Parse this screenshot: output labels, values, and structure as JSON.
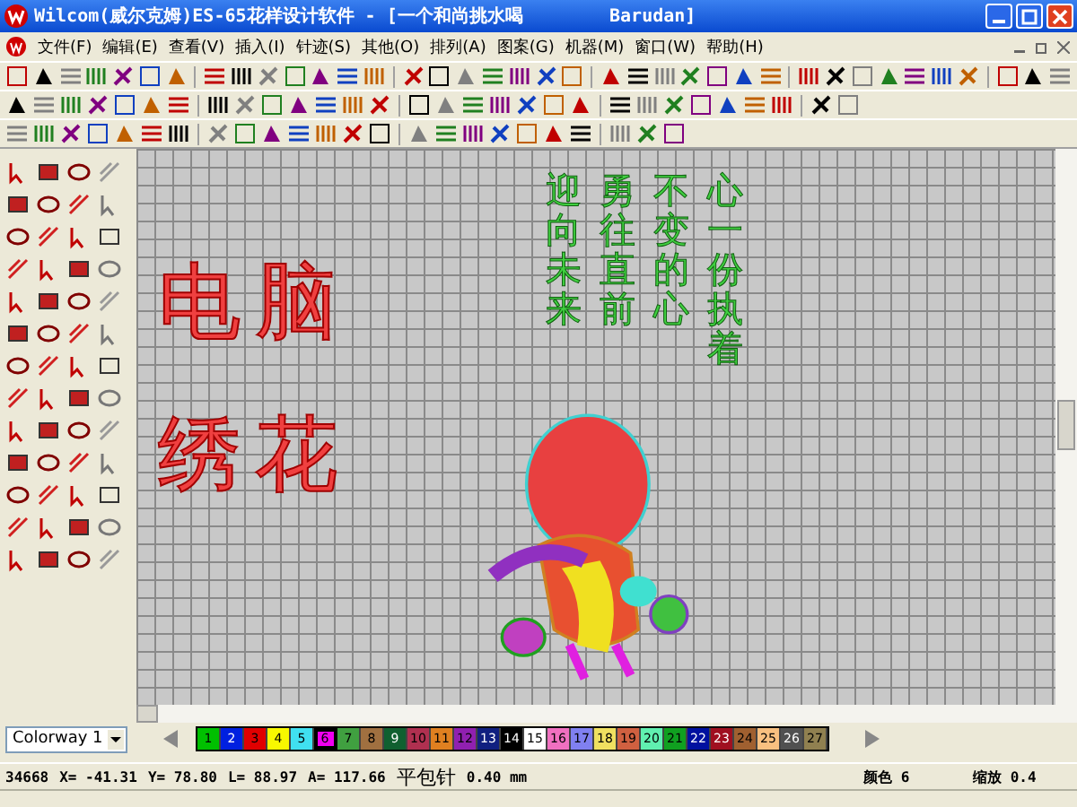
{
  "window": {
    "title": "Wilcom(威尔克姆)ES-65花样设计软件 - [一个和尚挑水喝        Barudan]"
  },
  "menu": [
    "文件(F)",
    "编辑(E)",
    "查看(V)",
    "插入(I)",
    "针迹(S)",
    "其他(O)",
    "排列(A)",
    "图案(G)",
    "机器(M)",
    "窗口(W)",
    "帮助(H)"
  ],
  "design": {
    "big_text": [
      "电脑",
      "绣花"
    ],
    "poem_columns": [
      "迎向未来",
      "勇往直前",
      "不变的心",
      "心一份执着"
    ]
  },
  "colorway": {
    "value": "Colorway 1"
  },
  "palette": [
    {
      "label": "1",
      "color": "#00c000",
      "selected": false
    },
    {
      "label": "2",
      "color": "#0020e0",
      "selected": false
    },
    {
      "label": "3",
      "color": "#e00000",
      "selected": false
    },
    {
      "label": "4",
      "color": "#f8f800",
      "selected": false
    },
    {
      "label": "5",
      "color": "#40e0f0",
      "selected": false
    },
    {
      "label": "6",
      "color": "#f000f0",
      "selected": true
    },
    {
      "label": "7",
      "color": "#40a040",
      "selected": false
    },
    {
      "label": "8",
      "color": "#a07040",
      "selected": false
    },
    {
      "label": "9",
      "color": "#106030",
      "selected": false
    },
    {
      "label": "10",
      "color": "#b03050",
      "selected": false
    },
    {
      "label": "11",
      "color": "#e08020",
      "selected": false
    },
    {
      "label": "12",
      "color": "#9020b0",
      "selected": false
    },
    {
      "label": "13",
      "color": "#102080",
      "selected": false
    },
    {
      "label": "14",
      "color": "#000000",
      "selected": false
    },
    {
      "label": "15",
      "color": "#ffffff",
      "selected": false
    },
    {
      "label": "16",
      "color": "#f070c0",
      "selected": false
    },
    {
      "label": "17",
      "color": "#8080f0",
      "selected": false
    },
    {
      "label": "18",
      "color": "#f0e060",
      "selected": false
    },
    {
      "label": "19",
      "color": "#d06040",
      "selected": false
    },
    {
      "label": "20",
      "color": "#60f0b0",
      "selected": false
    },
    {
      "label": "21",
      "color": "#10a020",
      "selected": false
    },
    {
      "label": "22",
      "color": "#0010a0",
      "selected": false
    },
    {
      "label": "23",
      "color": "#a01020",
      "selected": false
    },
    {
      "label": "24",
      "color": "#a06030",
      "selected": false
    },
    {
      "label": "25",
      "color": "#f8c080",
      "selected": false
    },
    {
      "label": "26",
      "color": "#505050",
      "selected": false
    },
    {
      "label": "27",
      "color": "#908050",
      "selected": false
    }
  ],
  "status": {
    "count": "34668",
    "x": "X= -41.31",
    "y": "Y= 78.80",
    "l": "L= 88.97",
    "a": "A= 117.66",
    "stitch": "平包针",
    "spacing": "0.40 mm",
    "thread": "颜色 6",
    "zoom": "缩放 0.4"
  }
}
